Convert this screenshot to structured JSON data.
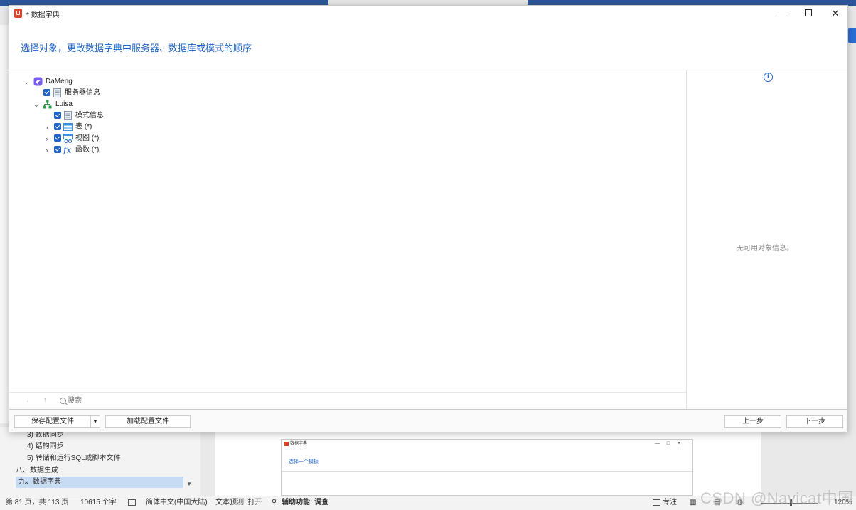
{
  "window": {
    "title": "* 数据字典"
  },
  "header": {
    "title": "选择对象，更改数据字典中服务器、数据库或模式的顺序"
  },
  "tree": {
    "root": {
      "label": "DaMeng"
    },
    "server_info": {
      "label": "服务器信息"
    },
    "schema": {
      "label": "Luisa"
    },
    "schema_info": {
      "label": "模式信息"
    },
    "tables": {
      "label": "表 (*)"
    },
    "views": {
      "label": "视图 (*)"
    },
    "functions": {
      "label": "函数 (*)"
    }
  },
  "info_panel": {
    "empty_text": "无可用对象信息。"
  },
  "search": {
    "placeholder": "搜索"
  },
  "footer": {
    "save_config": "保存配置文件",
    "load_config": "加载配置文件",
    "prev": "上一步",
    "next": "下一步"
  },
  "background": {
    "nav_items": [
      "3) 数据同步",
      "4) 结构同步",
      "5) 转储和运行SQL或脚本文件",
      "八、数据生成",
      "九、数据字典"
    ],
    "thumbnail": {
      "title": "数据字典",
      "heading": "选择一个模板"
    }
  },
  "statusbar": {
    "page": "第 81 页，共 113 页",
    "words": "10615 个字",
    "language": "简体中文(中国大陆)",
    "prediction": "文本预测: 打开",
    "accessibility": "辅助功能: 调查",
    "focus": "专注",
    "zoom": "120%"
  },
  "watermark": "CSDN @Navicat中国",
  "colors": {
    "accent": "#1f63c6",
    "word_blue": "#2b579a"
  }
}
